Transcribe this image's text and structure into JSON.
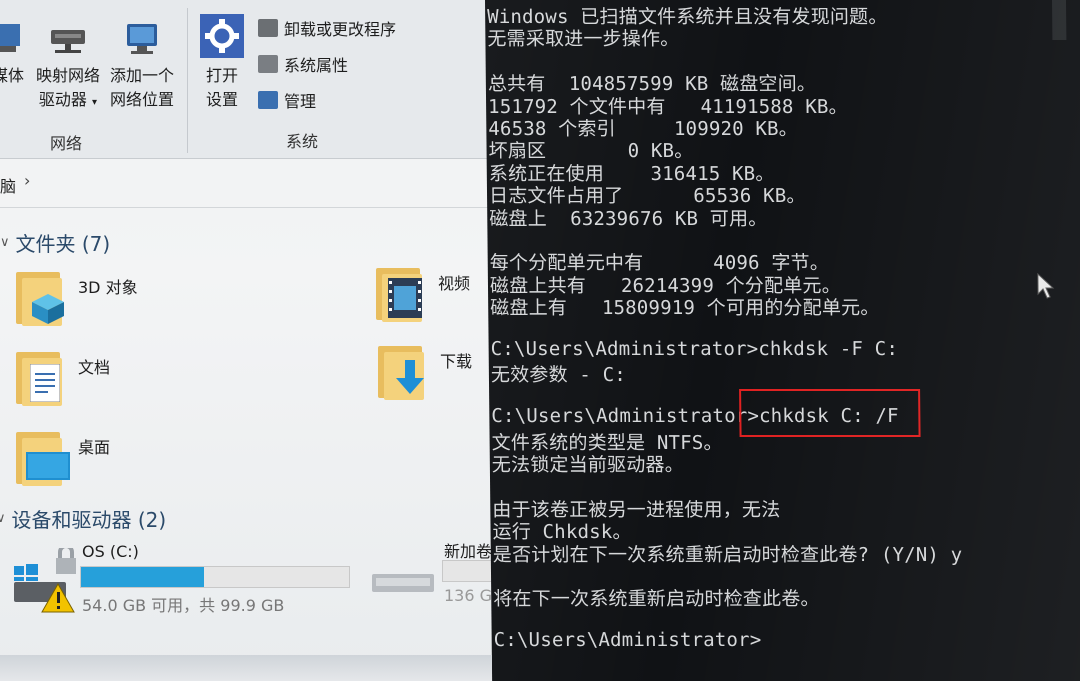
{
  "ribbon": {
    "btn_media_partial": "媒体",
    "btn_map_drive": [
      "映射网络",
      "驱动器"
    ],
    "btn_add_location": [
      "添加一个",
      "网络位置"
    ],
    "group_network": "网络",
    "btn_open_settings": [
      "打开",
      "设置"
    ],
    "small_uninstall": "卸载或更改程序",
    "small_system_props": "系统属性",
    "small_manage": "管理",
    "group_system": "系统"
  },
  "address": {
    "text_partial": "脑",
    "chevron": "›"
  },
  "folders": {
    "title": "文件夹 (7)",
    "items": [
      {
        "label": "3D 对象"
      },
      {
        "label": "视频"
      },
      {
        "label": "文档"
      },
      {
        "label": "下载"
      },
      {
        "label": "桌面"
      }
    ]
  },
  "devices": {
    "title": "设备和驱动器 (2)",
    "os_drive": {
      "name": "OS (C:)",
      "free_text": "54.0 GB 可用，共 99.9 GB",
      "used_fraction": 0.46
    },
    "new_volume": {
      "name_partial": "新加卷",
      "free_partial": "136 G"
    }
  },
  "cmd": {
    "lines": [
      "Windows 已扫描文件系统并且没有发现问题。",
      "无需采取进一步操作。",
      "",
      "总共有  104857599 KB 磁盘空间。",
      "151792 个文件中有   41191588 KB。",
      "46538 个索引     109920 KB。",
      "坏扇区       0 KB。",
      "系统正在使用    316415 KB。",
      "日志文件占用了      65536 KB。",
      "磁盘上  63239676 KB 可用。",
      "",
      "每个分配单元中有      4096 字节。",
      "磁盘上共有   26214399 个分配单元。",
      "磁盘上有   15809919 个可用的分配单元。",
      "",
      "C:\\Users\\Administrator>chkdsk -F C:",
      "无效参数 - C:",
      "",
      "C:\\Users\\Administrator>chkdsk C: /F",
      "文件系统的类型是 NTFS。",
      "无法锁定当前驱动器。",
      "",
      "由于该卷正被另一进程使用，无法",
      "运行 Chkdsk。",
      "是否计划在下一次系统重新启动时检查此卷? (Y/N) y",
      "",
      "将在下一次系统重新启动时检查此卷。",
      "",
      "C:\\Users\\Administrator>"
    ]
  },
  "colors": {
    "highlight": "#e02020",
    "drive_fill": "#26a0da",
    "terminal_bg": "#101215"
  }
}
